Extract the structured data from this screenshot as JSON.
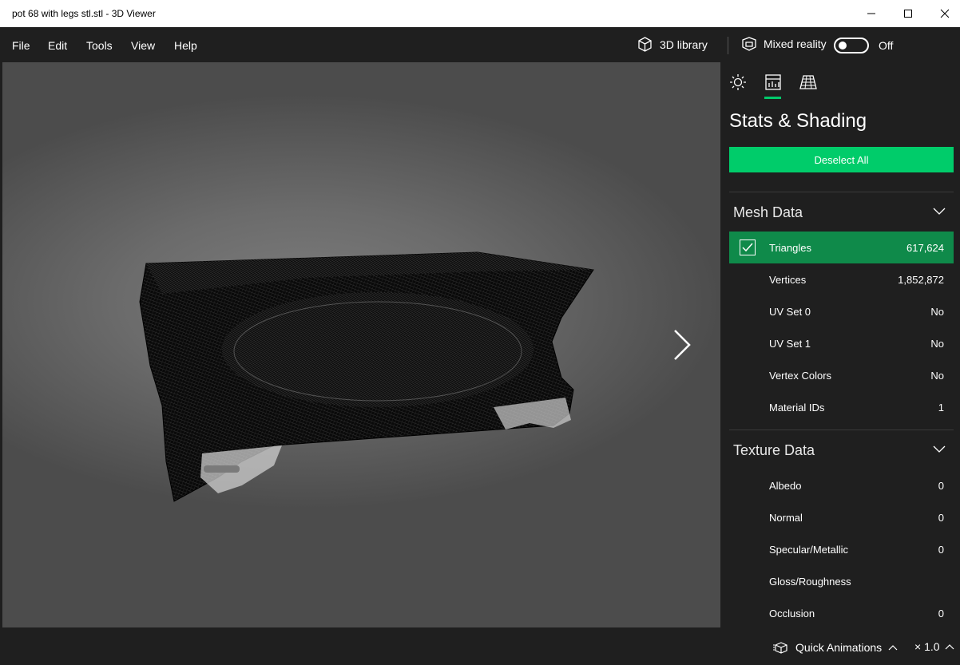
{
  "window": {
    "title": "pot 68 with legs stl.stl - 3D Viewer"
  },
  "menu": {
    "items": [
      "File",
      "Edit",
      "Tools",
      "View",
      "Help"
    ],
    "library_label": "3D library",
    "mixed_reality_label": "Mixed reality",
    "mixed_reality_state": "Off"
  },
  "panel": {
    "tabs": [
      "lighting-icon",
      "stats-icon",
      "grid-icon"
    ],
    "active_tab": "stats-icon",
    "title": "Stats & Shading",
    "deselect_label": "Deselect All",
    "accent": "#00cc6a",
    "mesh_section": "Mesh Data",
    "mesh_rows": [
      {
        "name": "Triangles",
        "value": "617,624",
        "selected": true
      },
      {
        "name": "Vertices",
        "value": "1,852,872"
      },
      {
        "name": "UV Set 0",
        "value": "No"
      },
      {
        "name": "UV Set 1",
        "value": "No"
      },
      {
        "name": "Vertex Colors",
        "value": "No"
      },
      {
        "name": "Material IDs",
        "value": "1"
      }
    ],
    "texture_section": "Texture Data",
    "texture_rows": [
      {
        "name": "Albedo",
        "value": "0"
      },
      {
        "name": "Normal",
        "value": "0"
      },
      {
        "name": "Specular/Metallic",
        "value": "0"
      },
      {
        "name": "Gloss/Roughness",
        "value": ""
      },
      {
        "name": "Occlusion",
        "value": "0"
      }
    ]
  },
  "bottom": {
    "animations_label": "Quick Animations",
    "speed": "× 1.0"
  }
}
